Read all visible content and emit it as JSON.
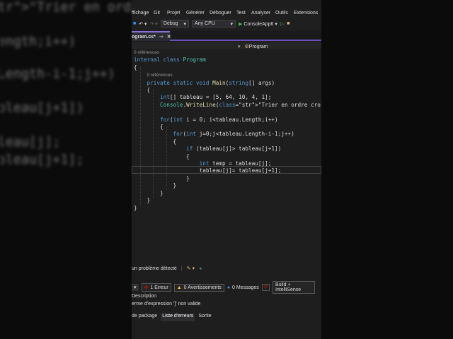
{
  "menu": [
    "ffichage",
    "Git",
    "Projet",
    "Générer",
    "Déboguer",
    "Test",
    "Analyser",
    "Outils",
    "Extensions"
  ],
  "toolbar": {
    "config": "Debug",
    "platform": "Any CPU",
    "run_label": "ConsoleApp6"
  },
  "tab": {
    "label": "ogram.cs*"
  },
  "navbar": {
    "class_label": "Program"
  },
  "code_lines": [
    "0 références",
    "internal class Program",
    "{",
    "    0 références",
    "    private static void Main(string[] args)",
    "    {",
    "        int[] tableau = [5, 64, 10, 4, 1];",
    "        Console.WriteLine(\"Trier en ordre croissant :\");",
    "",
    "        for(int i = 0; i<tableau.Length;i++)",
    "        {",
    "            for(int j=0;j<tableau.Length-i-1;j++)",
    "            {",
    "                if (tableau[j]> tableau[j+1])",
    "                {",
    "                    int temp = tableau[j];",
    "                    tableau[j]= tableau[j+1];",
    "                }",
    "            }",
    "        }",
    "    }",
    "}"
  ],
  "status": {
    "problems": "un problème détecté"
  },
  "error_list": {
    "errors": "1 Erreur",
    "warnings": "0 Avertissements",
    "messages": "0 Messages",
    "filter": "Build + IntelliSense",
    "col_description": "Description",
    "error_text": "erme d'expression ']' non valide"
  },
  "bottom_tabs": [
    "de package",
    "Liste d'erreurs",
    "Sortie"
  ],
  "colors": {
    "accent": "#8a6fd8",
    "error": "#e51400",
    "warning": "#f2c12e",
    "info": "#3794ff"
  }
}
